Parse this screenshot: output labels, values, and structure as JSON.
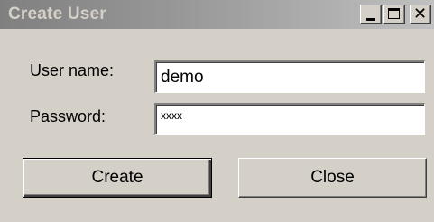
{
  "window": {
    "title": "Create User"
  },
  "titlebar_buttons": [
    {
      "icon": "minimize-icon"
    },
    {
      "icon": "maximize-icon"
    },
    {
      "icon": "close-icon",
      "glyph": "✕"
    }
  ],
  "form": {
    "username_label": "User name:",
    "username_value": "demo",
    "password_label": "Password:",
    "password_value": "xxxx"
  },
  "buttons": {
    "create_label": "Create",
    "close_label": "Close"
  },
  "colors": {
    "window_bg": "#d4d0c8",
    "titlebar_inactive_start": "#808080",
    "titlebar_inactive_end": "#c0c0c0",
    "title_text": "#d4d0c8"
  }
}
